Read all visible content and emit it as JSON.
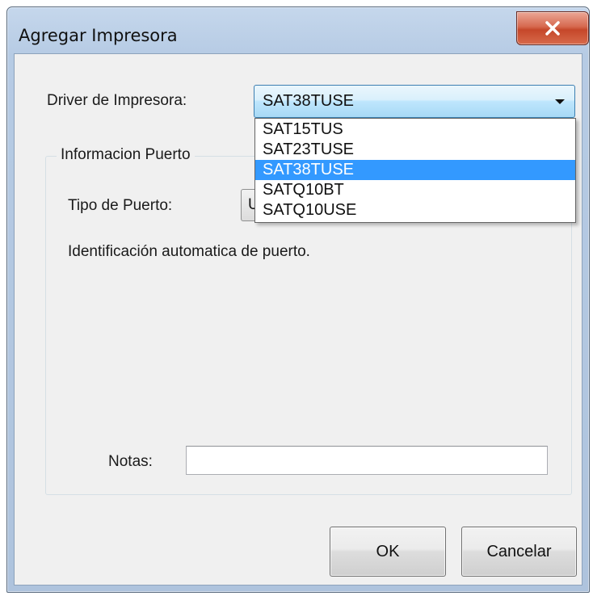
{
  "window": {
    "title": "Agregar Impresora"
  },
  "driver": {
    "label": "Driver de Impresora:",
    "selected": "SAT38TUSE",
    "options": [
      "SAT15TUS",
      "SAT23TUSE",
      "SAT38TUSE",
      "SATQ10BT",
      "SATQ10USE"
    ],
    "highlighted_index": 2
  },
  "port_group": {
    "caption": "Informacion Puerto",
    "type_label": "Tipo  de Puerto:",
    "type_value_partial": "U",
    "auto_text": "Identificación automatica de puerto."
  },
  "notes": {
    "label": "Notas:",
    "value": ""
  },
  "buttons": {
    "ok": "OK",
    "cancel": "Cancelar"
  },
  "colors": {
    "selection": "#3399ff",
    "close_button": "#c5472a"
  }
}
